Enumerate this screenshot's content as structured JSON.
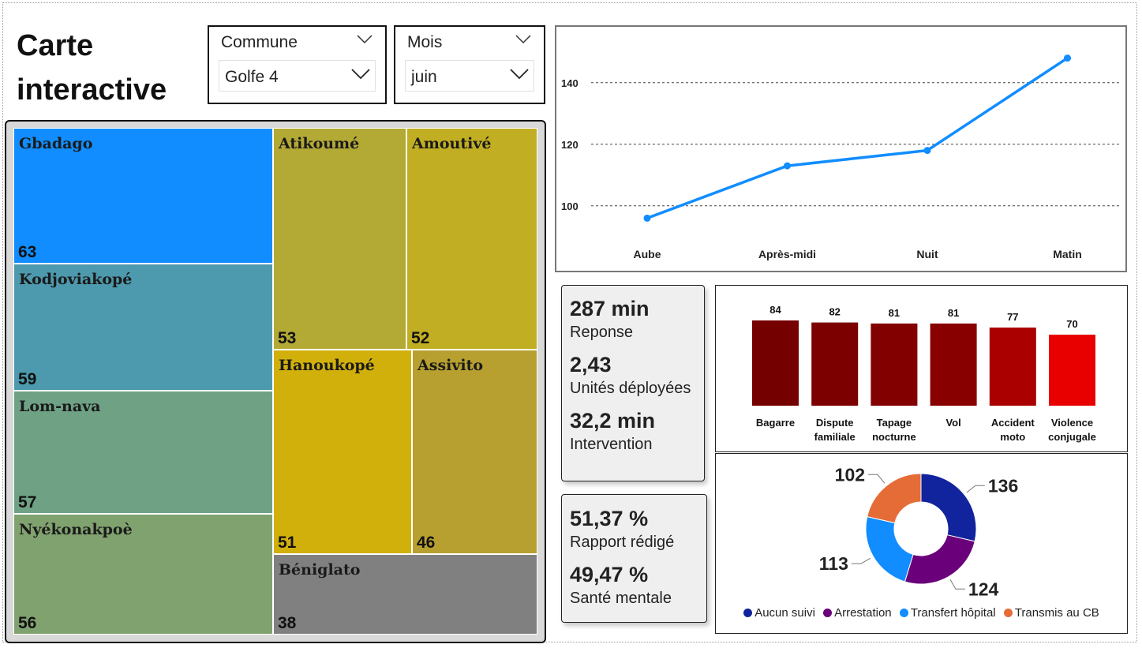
{
  "page": {
    "title_line1": "Carte",
    "title_line2": "interactive"
  },
  "filters": {
    "commune": {
      "label": "Commune",
      "value": "Golfe 4"
    },
    "mois": {
      "label": "Mois",
      "value": "juin"
    }
  },
  "treemap": {
    "tiles": [
      {
        "name": "Gbadago",
        "value": 63,
        "color": "#118dff"
      },
      {
        "name": "Kodjoviakopé",
        "value": 59,
        "color": "#4d99ad"
      },
      {
        "name": "Lom-nava",
        "value": 57,
        "color": "#6fa185"
      },
      {
        "name": "Nyékonakpoè",
        "value": 56,
        "color": "#80a26f"
      },
      {
        "name": "Atikoumé",
        "value": 53,
        "color": "#b3a935"
      },
      {
        "name": "Amoutivé",
        "value": 52,
        "color": "#c1ae22"
      },
      {
        "name": "Hanoukopé",
        "value": 51,
        "color": "#d2b00b"
      },
      {
        "name": "Assivito",
        "value": 46,
        "color": "#b7a030"
      },
      {
        "name": "Béniglato",
        "value": 38,
        "color": "#808080"
      }
    ]
  },
  "kpis": {
    "reponse": {
      "value": "287 min",
      "label": "Reponse"
    },
    "unites": {
      "value": "2,43",
      "label": "Unités déployées"
    },
    "intervention": {
      "value": "32,2 min",
      "label": "Intervention"
    },
    "rapport": {
      "value": "51,37 %",
      "label": "Rapport rédigé"
    },
    "sante": {
      "value": "49,47 %",
      "label": "Santé mentale"
    }
  },
  "chart_data": [
    {
      "type": "line",
      "categories": [
        "Aube",
        "Après-midi",
        "Nuit",
        "Matin"
      ],
      "values": [
        96,
        113,
        118,
        148
      ],
      "yticks": [
        100,
        120,
        140
      ],
      "ylim": [
        92,
        152
      ],
      "grid": true,
      "color": "#118dff"
    },
    {
      "type": "bar",
      "categories": [
        "Bagarre",
        "Dispute familiale",
        "Tapage nocturne",
        "Vol",
        "Accident moto",
        "Violence conjugale"
      ],
      "values": [
        84,
        82,
        81,
        81,
        77,
        70
      ],
      "colors": [
        "#750000",
        "#7c0000",
        "#830000",
        "#880000",
        "#aa0000",
        "#e80000"
      ]
    },
    {
      "type": "pie",
      "donut": true,
      "labels": [
        "Aucun suivi",
        "Arrestation",
        "Transfert hôpital",
        "Transmis au CB"
      ],
      "values": [
        136,
        124,
        113,
        102
      ],
      "colors": [
        "#12239e",
        "#6b007b",
        "#118dff",
        "#e66c37"
      ]
    }
  ]
}
